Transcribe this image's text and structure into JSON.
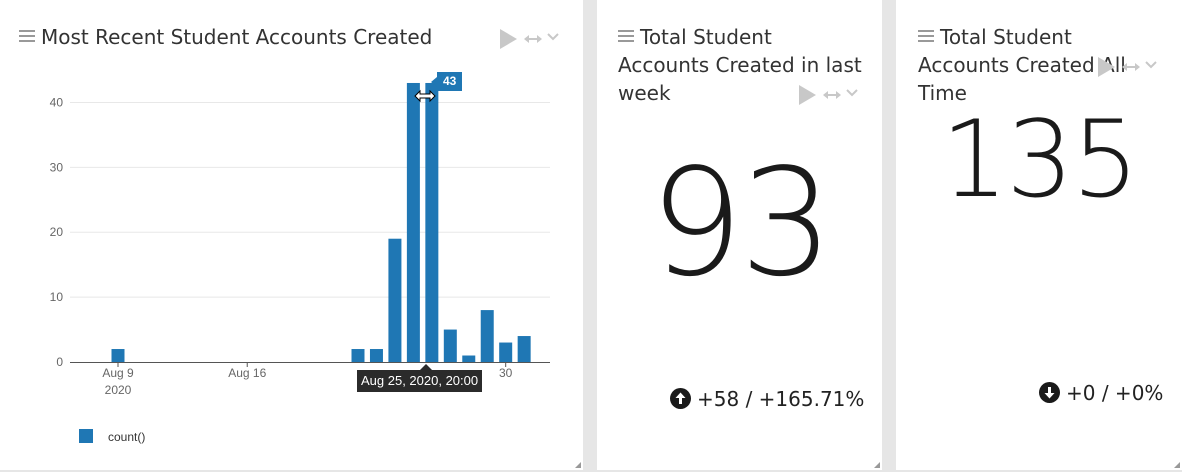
{
  "panels": {
    "recent": {
      "title": "Most Recent Student Accounts Created"
    },
    "week": {
      "title": "Total Student Accounts Created in last week",
      "value": "93",
      "change": "+58 / +165.71%",
      "change_direction": "up"
    },
    "alltime": {
      "title": "Total Student Accounts Created All Time",
      "value": "135",
      "change": "+0 / +0%",
      "change_direction": "down"
    }
  },
  "tooltips": {
    "value": "43",
    "date": "Aug 25, 2020, 20:00"
  },
  "colors": {
    "bar": "#1f77b4",
    "grid": "#e8e8e8",
    "axis": "#555555"
  },
  "chart_data": {
    "type": "bar",
    "title": "",
    "xlabel": "",
    "ylabel": "",
    "ylim": [
      0,
      45
    ],
    "yticks": [
      0,
      10,
      20,
      30,
      40
    ],
    "xticks": [
      {
        "x": 9,
        "label": "Aug 9",
        "sublabel": "2020"
      },
      {
        "x": 16,
        "label": "Aug 16",
        "sublabel": ""
      },
      {
        "x": 30,
        "label": "30",
        "sublabel": ""
      }
    ],
    "grid": true,
    "legend": "bottom-left",
    "series": [
      {
        "name": "count()",
        "color": "#1f77b4",
        "points": [
          {
            "x": 9,
            "y": 2
          },
          {
            "x": 22,
            "y": 2
          },
          {
            "x": 23,
            "y": 2
          },
          {
            "x": 24,
            "y": 19
          },
          {
            "x": 25,
            "y": 43
          },
          {
            "x": 26,
            "y": 43
          },
          {
            "x": 27,
            "y": 5
          },
          {
            "x": 28,
            "y": 1
          },
          {
            "x": 29,
            "y": 8
          },
          {
            "x": 30,
            "y": 3
          },
          {
            "x": 31,
            "y": 4
          }
        ]
      }
    ]
  }
}
